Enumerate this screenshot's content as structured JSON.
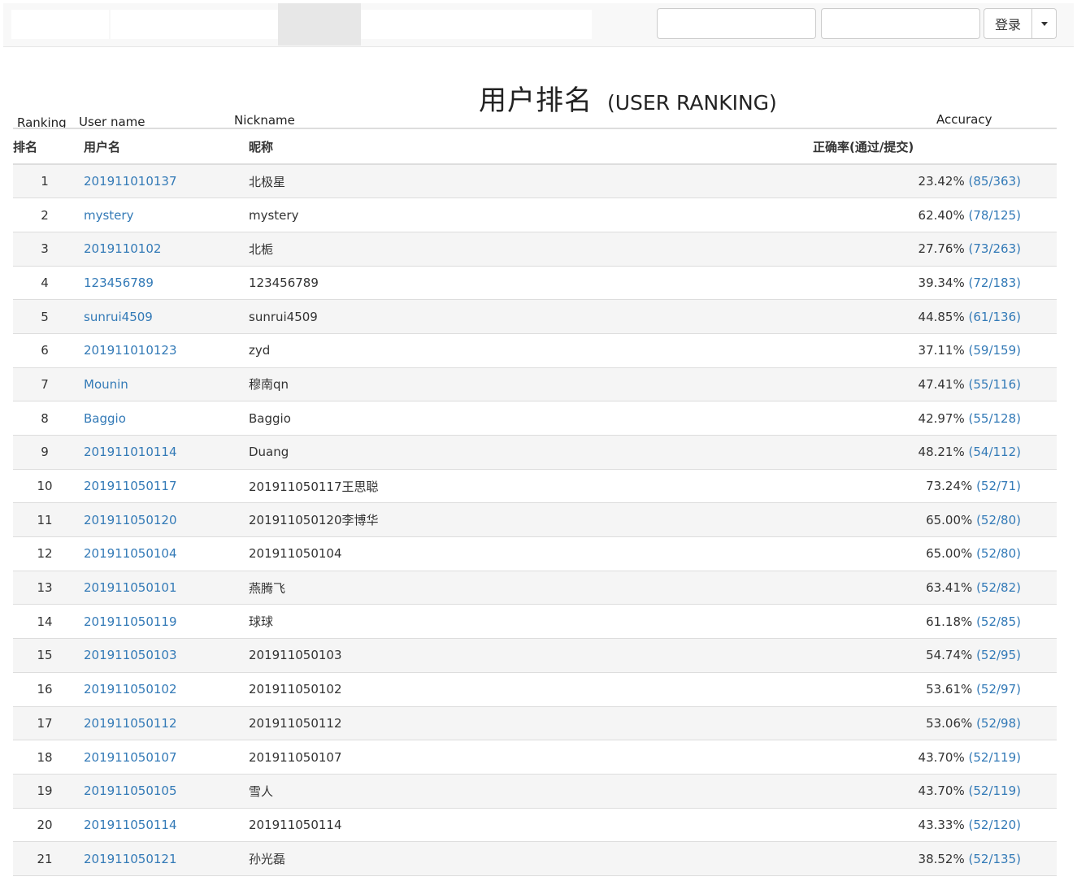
{
  "navbar": {
    "login_label": "登录"
  },
  "title": {
    "cn": "用户排名",
    "en": "(USER RANKING)"
  },
  "captions": {
    "ranking": "Ranking",
    "user_name": "User name",
    "nickname": "Nickname",
    "accuracy": "Accuracy"
  },
  "table": {
    "headers": [
      "排名",
      "用户名",
      "昵称",
      "正确率(通过/提交)"
    ],
    "rows": [
      {
        "rank": "1",
        "user": "201911010137",
        "nick": "北极星",
        "pct": "23.42%",
        "ratio": "(85/363)"
      },
      {
        "rank": "2",
        "user": "mystery",
        "nick": "mystery",
        "pct": "62.40%",
        "ratio": "(78/125)"
      },
      {
        "rank": "3",
        "user": "2019110102",
        "nick": "北栀",
        "pct": "27.76%",
        "ratio": "(73/263)"
      },
      {
        "rank": "4",
        "user": "123456789",
        "nick": "123456789",
        "pct": "39.34%",
        "ratio": "(72/183)"
      },
      {
        "rank": "5",
        "user": "sunrui4509",
        "nick": "sunrui4509",
        "pct": "44.85%",
        "ratio": "(61/136)"
      },
      {
        "rank": "6",
        "user": "201911010123",
        "nick": "zyd",
        "pct": "37.11%",
        "ratio": "(59/159)"
      },
      {
        "rank": "7",
        "user": "Mounin",
        "nick": "穆南qn",
        "pct": "47.41%",
        "ratio": "(55/116)"
      },
      {
        "rank": "8",
        "user": "Baggio",
        "nick": "Baggio",
        "pct": "42.97%",
        "ratio": "(55/128)"
      },
      {
        "rank": "9",
        "user": "201911010114",
        "nick": "Duang",
        "pct": "48.21%",
        "ratio": "(54/112)"
      },
      {
        "rank": "10",
        "user": "201911050117",
        "nick": "201911050117王思聪",
        "pct": "73.24%",
        "ratio": "(52/71)"
      },
      {
        "rank": "11",
        "user": "201911050120",
        "nick": "201911050120李博华",
        "pct": "65.00%",
        "ratio": "(52/80)"
      },
      {
        "rank": "12",
        "user": "201911050104",
        "nick": "201911050104",
        "pct": "65.00%",
        "ratio": "(52/80)"
      },
      {
        "rank": "13",
        "user": "201911050101",
        "nick": "燕腾飞",
        "pct": "63.41%",
        "ratio": "(52/82)"
      },
      {
        "rank": "14",
        "user": "201911050119",
        "nick": "球球",
        "pct": "61.18%",
        "ratio": "(52/85)"
      },
      {
        "rank": "15",
        "user": "201911050103",
        "nick": "201911050103",
        "pct": "54.74%",
        "ratio": "(52/95)"
      },
      {
        "rank": "16",
        "user": "201911050102",
        "nick": "201911050102",
        "pct": "53.61%",
        "ratio": "(52/97)"
      },
      {
        "rank": "17",
        "user": "201911050112",
        "nick": "201911050112",
        "pct": "53.06%",
        "ratio": "(52/98)"
      },
      {
        "rank": "18",
        "user": "201911050107",
        "nick": "201911050107",
        "pct": "43.70%",
        "ratio": "(52/119)"
      },
      {
        "rank": "19",
        "user": "201911050105",
        "nick": "雪人",
        "pct": "43.70%",
        "ratio": "(52/119)"
      },
      {
        "rank": "20",
        "user": "201911050114",
        "nick": "201911050114",
        "pct": "43.33%",
        "ratio": "(52/120)"
      },
      {
        "rank": "21",
        "user": "201911050121",
        "nick": "孙光磊",
        "pct": "38.52%",
        "ratio": "(52/135)"
      }
    ]
  },
  "colors": {
    "link": "#337ab7",
    "text": "#333333",
    "stripe": "#f5f5f5",
    "border": "#dddddd",
    "navbar_bg": "#f8f8f8"
  }
}
